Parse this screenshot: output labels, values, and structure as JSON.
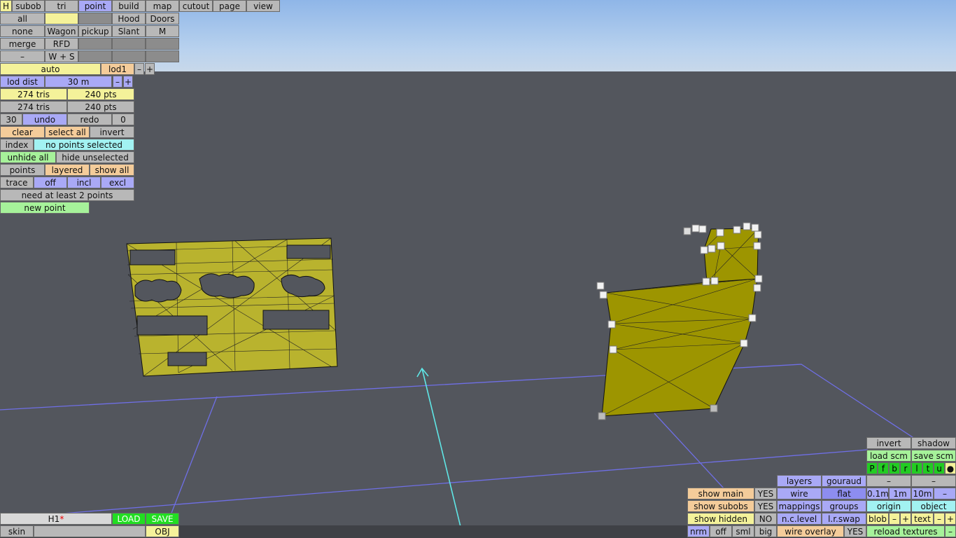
{
  "topmenu": {
    "h": "H",
    "subob": "subob",
    "tri": "tri",
    "point": "point",
    "build": "build",
    "map": "map",
    "cutout": "cutout",
    "page": "page",
    "view": "view"
  },
  "sel": {
    "all": "all",
    "none": "none",
    "merge": "merge",
    "minus": "–",
    "blank": "",
    "wagon": "Wagon",
    "rfd": "RFD",
    "ws": "W + S",
    "pickup": "pickup",
    "hood": "Hood",
    "doors": "Doors",
    "slant": "Slant",
    "m": "M"
  },
  "lod": {
    "auto": "auto",
    "lod1": "lod1",
    "minus": "–",
    "plus": "+",
    "dist_label": "lod dist",
    "dist_value": "30 m",
    "tris1": "274 tris",
    "pts1": "240 pts",
    "tris2": "274 tris",
    "pts2": "240 pts"
  },
  "undo": {
    "count": "30",
    "undo": "undo",
    "redo": "redo",
    "redo_count": "0"
  },
  "select": {
    "clear": "clear",
    "select_all": "select all",
    "invert": "invert",
    "index": "index",
    "status": "no points selected",
    "unhide_all": "unhide all",
    "hide_unselected": "hide unselected",
    "points": "points",
    "layered": "layered",
    "show_all": "show all",
    "trace": "trace",
    "off": "off",
    "incl": "incl",
    "excl": "excl",
    "need": "need at least 2 points",
    "new_point": "new point"
  },
  "file": {
    "name": "H1",
    "modified": "*",
    "load": "LOAD",
    "save": "SAVE",
    "skin": "skin",
    "skin_value": "",
    "obj": "OBJ"
  },
  "view": {
    "show_main": "show main",
    "show_main_v": "YES",
    "show_subobs": "show subobs",
    "show_subobs_v": "YES",
    "show_hidden": "show hidden",
    "show_hidden_v": "NO",
    "nrm": "nrm",
    "off": "off",
    "sml": "sml",
    "big": "big",
    "layers": "layers",
    "gouraud": "gouraud",
    "wire": "wire",
    "flat": "flat",
    "mappings": "mappings",
    "groups": "groups",
    "nclevel": "n.c.level",
    "lrswap": "l.r.swap",
    "wire_overlay": "wire overlay",
    "wire_overlay_v": "YES",
    "invert": "invert",
    "shadow": "shadow",
    "load_scm": "load scm",
    "save_scm": "save scm",
    "channels": [
      "P",
      "f",
      "b",
      "r",
      "l",
      "t",
      "u",
      "●"
    ],
    "dash1": "–",
    "dash2": "–",
    "g01": "0.1m",
    "g1": "1m",
    "g10": "10m",
    "gminus": "–",
    "origin": "origin",
    "object": "object",
    "blob": "blob",
    "blob_minus": "–",
    "blob_plus": "+",
    "text": "text",
    "text_minus": "–",
    "text_plus": "+",
    "reload": "reload textures",
    "reload_minus": "–"
  }
}
